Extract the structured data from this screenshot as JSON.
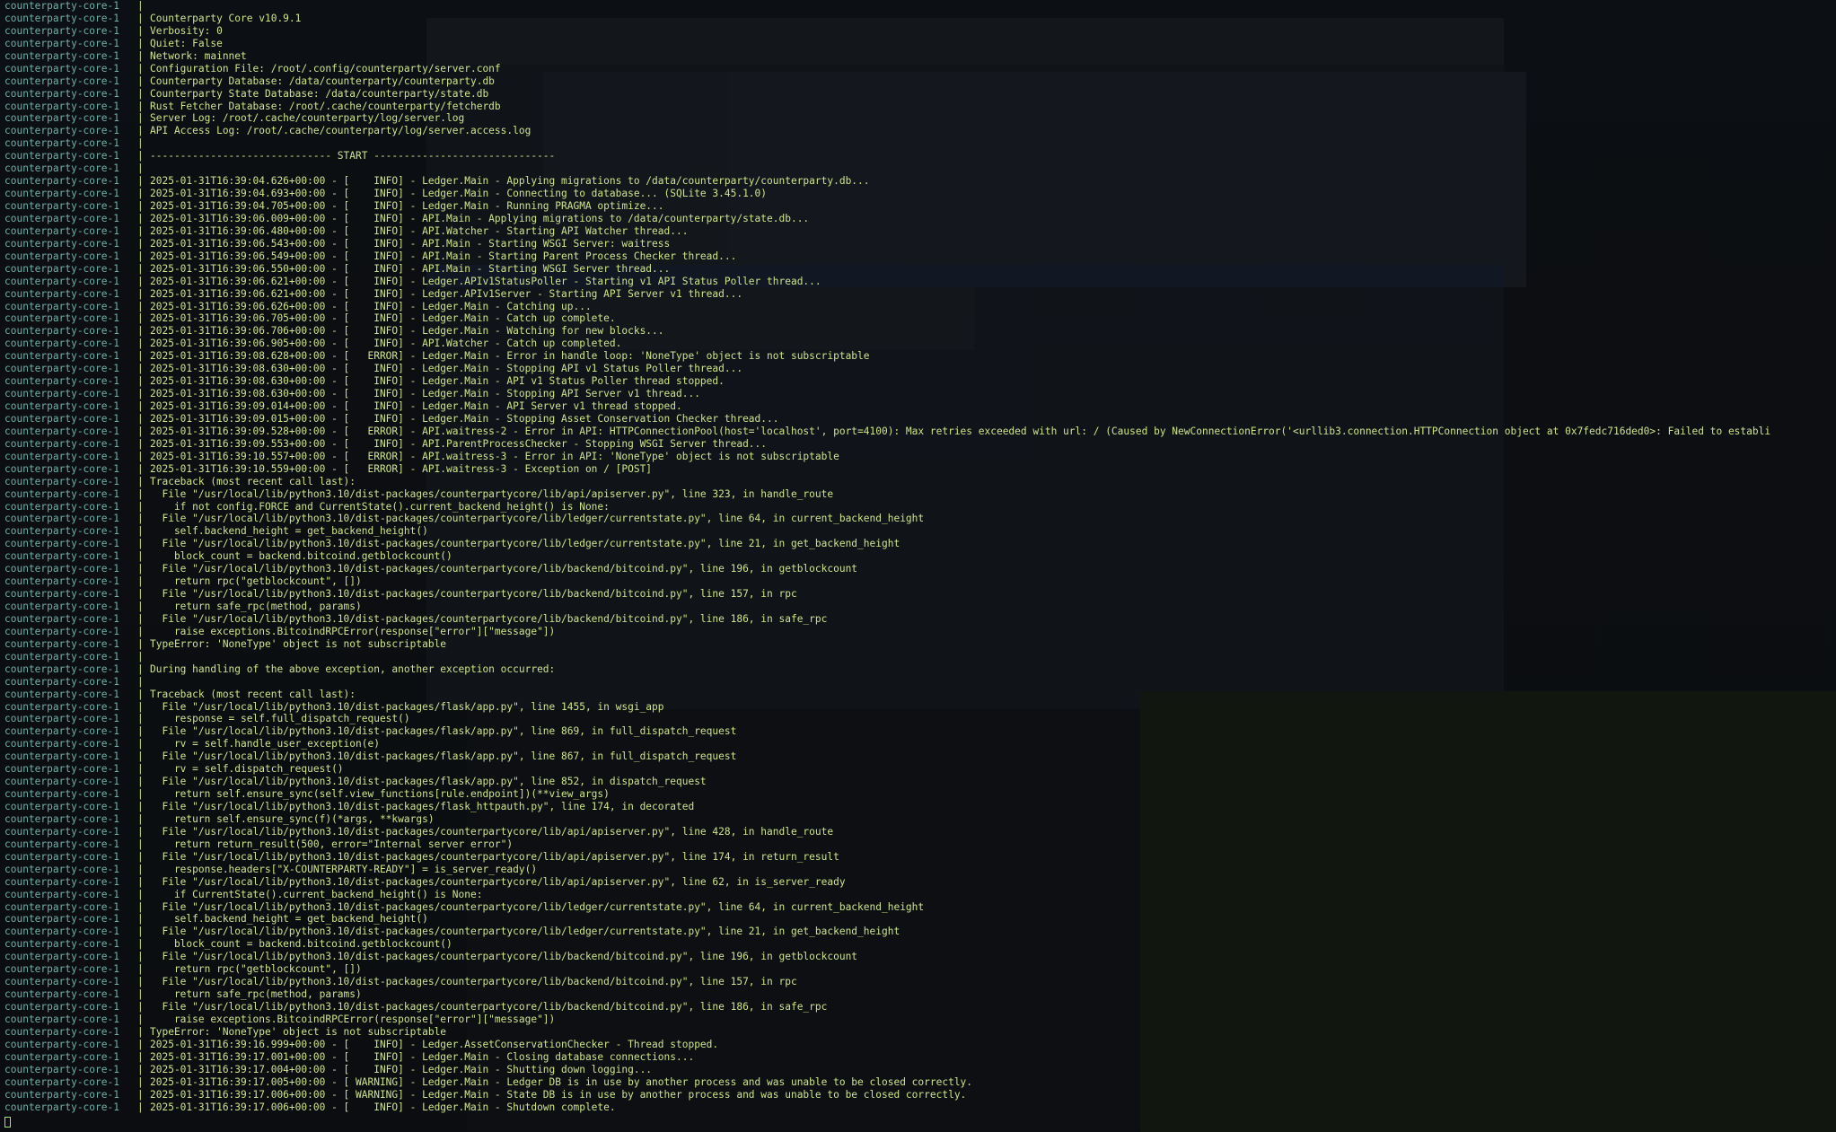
{
  "terminal": {
    "container_name": "counterparty-core-1",
    "separator": "|",
    "lines": [
      "",
      "Counterparty Core v10.9.1",
      "Verbosity: 0",
      "Quiet: False",
      "Network: mainnet",
      "Configuration File: /root/.config/counterparty/server.conf",
      "Counterparty Database: /data/counterparty/counterparty.db",
      "Counterparty State Database: /data/counterparty/state.db",
      "Rust Fetcher Database: /root/.cache/counterparty/fetcherdb",
      "Server Log: /root/.cache/counterparty/log/server.log",
      "API Access Log: /root/.cache/counterparty/log/server.access.log",
      "",
      "------------------------------ START ------------------------------",
      "",
      "2025-01-31T16:39:04.626+00:00 - [    INFO] - Ledger.Main - Applying migrations to /data/counterparty/counterparty.db...",
      "2025-01-31T16:39:04.693+00:00 - [    INFO] - Ledger.Main - Connecting to database... (SQLite 3.45.1.0)",
      "2025-01-31T16:39:04.705+00:00 - [    INFO] - Ledger.Main - Running PRAGMA optimize...",
      "2025-01-31T16:39:06.009+00:00 - [    INFO] - API.Main - Applying migrations to /data/counterparty/state.db...",
      "2025-01-31T16:39:06.480+00:00 - [    INFO] - API.Watcher - Starting API Watcher thread...",
      "2025-01-31T16:39:06.543+00:00 - [    INFO] - API.Main - Starting WSGI Server: waitress",
      "2025-01-31T16:39:06.549+00:00 - [    INFO] - API.Main - Starting Parent Process Checker thread...",
      "2025-01-31T16:39:06.550+00:00 - [    INFO] - API.Main - Starting WSGI Server thread...",
      "2025-01-31T16:39:06.621+00:00 - [    INFO] - Ledger.APIv1StatusPoller - Starting v1 API Status Poller thread...",
      "2025-01-31T16:39:06.621+00:00 - [    INFO] - Ledger.APIv1Server - Starting API Server v1 thread...",
      "2025-01-31T16:39:06.626+00:00 - [    INFO] - Ledger.Main - Catching up...",
      "2025-01-31T16:39:06.705+00:00 - [    INFO] - Ledger.Main - Catch up complete.",
      "2025-01-31T16:39:06.706+00:00 - [    INFO] - Ledger.Main - Watching for new blocks...",
      "2025-01-31T16:39:06.905+00:00 - [    INFO] - API.Watcher - Catch up completed.",
      "2025-01-31T16:39:08.628+00:00 - [   ERROR] - Ledger.Main - Error in handle loop: 'NoneType' object is not subscriptable",
      "2025-01-31T16:39:08.630+00:00 - [    INFO] - Ledger.Main - Stopping API v1 Status Poller thread...",
      "2025-01-31T16:39:08.630+00:00 - [    INFO] - Ledger.Main - API v1 Status Poller thread stopped.",
      "2025-01-31T16:39:08.630+00:00 - [    INFO] - Ledger.Main - Stopping API Server v1 thread...",
      "2025-01-31T16:39:09.014+00:00 - [    INFO] - Ledger.Main - API Server v1 thread stopped.",
      "2025-01-31T16:39:09.015+00:00 - [    INFO] - Ledger.Main - Stopping Asset Conservation Checker thread...",
      "2025-01-31T16:39:09.528+00:00 - [   ERROR] - API.waitress-2 - Error in API: HTTPConnectionPool(host='localhost', port=4100): Max retries exceeded with url: / (Caused by NewConnectionError('<urllib3.connection.HTTPConnection object at 0x7fedc716ded0>: Failed to establi",
      "2025-01-31T16:39:09.553+00:00 - [    INFO] - API.ParentProcessChecker - Stopping WSGI Server thread...",
      "2025-01-31T16:39:10.557+00:00 - [   ERROR] - API.waitress-3 - Error in API: 'NoneType' object is not subscriptable",
      "2025-01-31T16:39:10.559+00:00 - [   ERROR] - API.waitress-3 - Exception on / [POST]",
      "Traceback (most recent call last):",
      "  File \"/usr/local/lib/python3.10/dist-packages/counterpartycore/lib/api/apiserver.py\", line 323, in handle_route",
      "    if not config.FORCE and CurrentState().current_backend_height() is None:",
      "  File \"/usr/local/lib/python3.10/dist-packages/counterpartycore/lib/ledger/currentstate.py\", line 64, in current_backend_height",
      "    self.backend_height = get_backend_height()",
      "  File \"/usr/local/lib/python3.10/dist-packages/counterpartycore/lib/ledger/currentstate.py\", line 21, in get_backend_height",
      "    block_count = backend.bitcoind.getblockcount()",
      "  File \"/usr/local/lib/python3.10/dist-packages/counterpartycore/lib/backend/bitcoind.py\", line 196, in getblockcount",
      "    return rpc(\"getblockcount\", [])",
      "  File \"/usr/local/lib/python3.10/dist-packages/counterpartycore/lib/backend/bitcoind.py\", line 157, in rpc",
      "    return safe_rpc(method, params)",
      "  File \"/usr/local/lib/python3.10/dist-packages/counterpartycore/lib/backend/bitcoind.py\", line 186, in safe_rpc",
      "    raise exceptions.BitcoindRPCError(response[\"error\"][\"message\"])",
      "TypeError: 'NoneType' object is not subscriptable",
      "",
      "During handling of the above exception, another exception occurred:",
      "",
      "Traceback (most recent call last):",
      "  File \"/usr/local/lib/python3.10/dist-packages/flask/app.py\", line 1455, in wsgi_app",
      "    response = self.full_dispatch_request()",
      "  File \"/usr/local/lib/python3.10/dist-packages/flask/app.py\", line 869, in full_dispatch_request",
      "    rv = self.handle_user_exception(e)",
      "  File \"/usr/local/lib/python3.10/dist-packages/flask/app.py\", line 867, in full_dispatch_request",
      "    rv = self.dispatch_request()",
      "  File \"/usr/local/lib/python3.10/dist-packages/flask/app.py\", line 852, in dispatch_request",
      "    return self.ensure_sync(self.view_functions[rule.endpoint])(**view_args)",
      "  File \"/usr/local/lib/python3.10/dist-packages/flask_httpauth.py\", line 174, in decorated",
      "    return self.ensure_sync(f)(*args, **kwargs)",
      "  File \"/usr/local/lib/python3.10/dist-packages/counterpartycore/lib/api/apiserver.py\", line 428, in handle_route",
      "    return return_result(500, error=\"Internal server error\")",
      "  File \"/usr/local/lib/python3.10/dist-packages/counterpartycore/lib/api/apiserver.py\", line 174, in return_result",
      "    response.headers[\"X-COUNTERPARTY-READY\"] = is_server_ready()",
      "  File \"/usr/local/lib/python3.10/dist-packages/counterpartycore/lib/api/apiserver.py\", line 62, in is_server_ready",
      "    if CurrentState().current_backend_height() is None:",
      "  File \"/usr/local/lib/python3.10/dist-packages/counterpartycore/lib/ledger/currentstate.py\", line 64, in current_backend_height",
      "    self.backend_height = get_backend_height()",
      "  File \"/usr/local/lib/python3.10/dist-packages/counterpartycore/lib/ledger/currentstate.py\", line 21, in get_backend_height",
      "    block_count = backend.bitcoind.getblockcount()",
      "  File \"/usr/local/lib/python3.10/dist-packages/counterpartycore/lib/backend/bitcoind.py\", line 196, in getblockcount",
      "    return rpc(\"getblockcount\", [])",
      "  File \"/usr/local/lib/python3.10/dist-packages/counterpartycore/lib/backend/bitcoind.py\", line 157, in rpc",
      "    return safe_rpc(method, params)",
      "  File \"/usr/local/lib/python3.10/dist-packages/counterpartycore/lib/backend/bitcoind.py\", line 186, in safe_rpc",
      "    raise exceptions.BitcoindRPCError(response[\"error\"][\"message\"])",
      "TypeError: 'NoneType' object is not subscriptable",
      "2025-01-31T16:39:16.999+00:00 - [    INFO] - Ledger.AssetConservationChecker - Thread stopped.",
      "2025-01-31T16:39:17.001+00:00 - [    INFO] - Ledger.Main - Closing database connections...",
      "2025-01-31T16:39:17.004+00:00 - [    INFO] - Ledger.Main - Shutting down logging...",
      "2025-01-31T16:39:17.005+00:00 - [ WARNING] - Ledger.Main - Ledger DB is in use by another process and was unable to be closed correctly.",
      "2025-01-31T16:39:17.006+00:00 - [ WARNING] - Ledger.Main - State DB is in use by another process and was unable to be closed correctly.",
      "2025-01-31T16:39:17.006+00:00 - [    INFO] - Ledger.Main - Shutdown complete."
    ]
  },
  "colors": {
    "background": "#0b0d10",
    "prefix": "#6fb0a8",
    "text": "#cfe48a",
    "cursor": "#9fe86a"
  }
}
